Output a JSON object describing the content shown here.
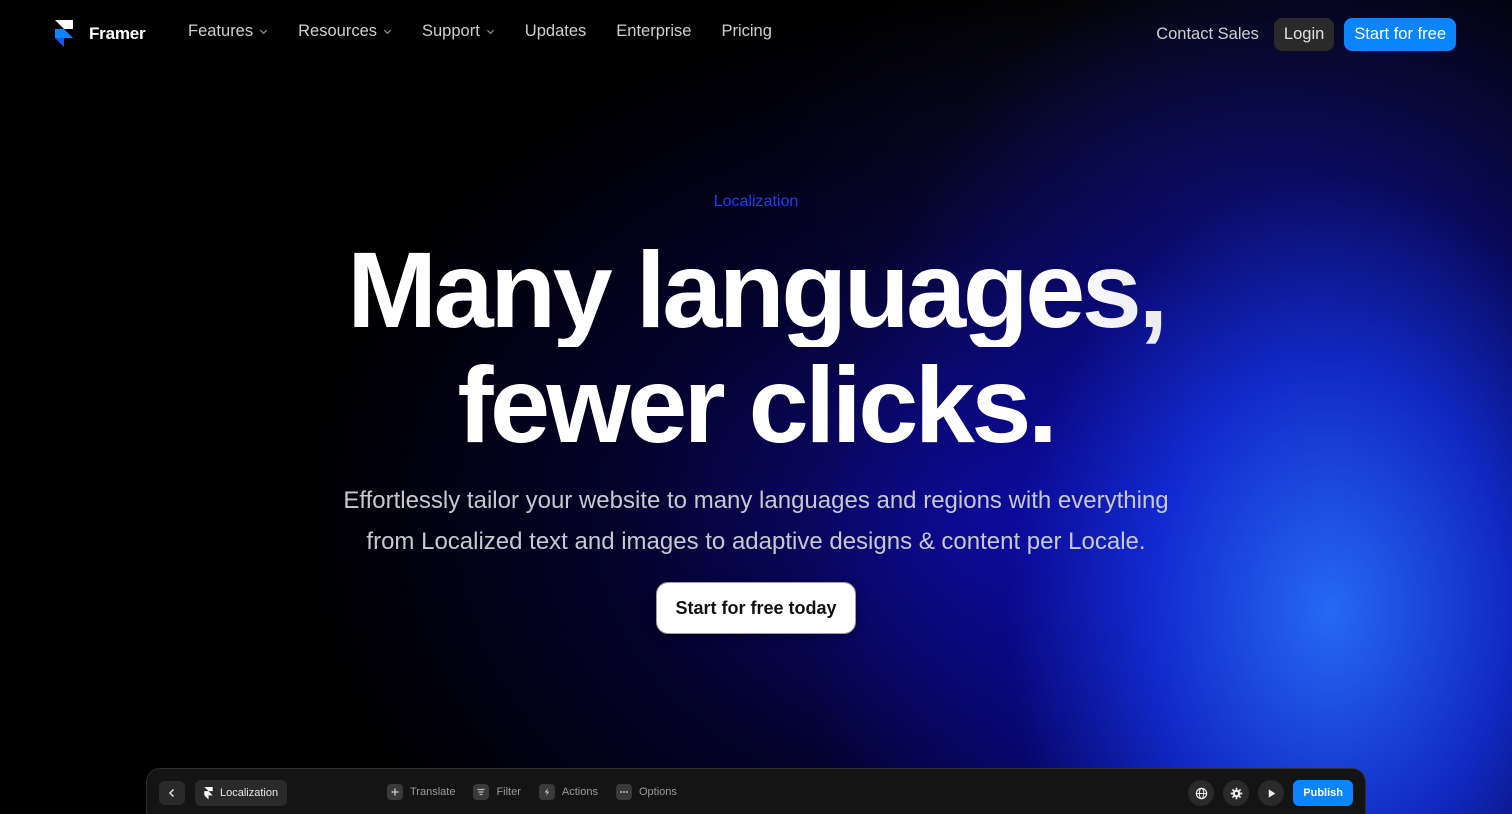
{
  "nav": {
    "brand": "Framer",
    "links": [
      {
        "label": "Features",
        "has_dropdown": true
      },
      {
        "label": "Resources",
        "has_dropdown": true
      },
      {
        "label": "Support",
        "has_dropdown": true
      },
      {
        "label": "Updates",
        "has_dropdown": false
      },
      {
        "label": "Enterprise",
        "has_dropdown": false
      },
      {
        "label": "Pricing",
        "has_dropdown": false
      }
    ],
    "contact_sales": "Contact Sales",
    "login": "Login",
    "start_free": "Start for free"
  },
  "hero": {
    "eyebrow": "Localization",
    "headline_line1": "Many languages,",
    "headline_line2": "fewer clicks.",
    "subtitle_line1": "Effortlessly tailor your website to many languages and regions with everything",
    "subtitle_line2": "from Localized text and images to adaptive designs & content per Locale.",
    "cta": "Start for free today"
  },
  "toolbar": {
    "chip_label": "Localization",
    "tools": [
      {
        "label": "Translate",
        "icon": "plus-square-icon"
      },
      {
        "label": "Filter",
        "icon": "filter-icon"
      },
      {
        "label": "Actions",
        "icon": "bolt-icon"
      },
      {
        "label": "Options",
        "icon": "dots-icon"
      }
    ],
    "publish": "Publish"
  },
  "colors": {
    "accent": "#0a84ff",
    "eyebrow": "#1e3cff",
    "background": "#000000"
  }
}
